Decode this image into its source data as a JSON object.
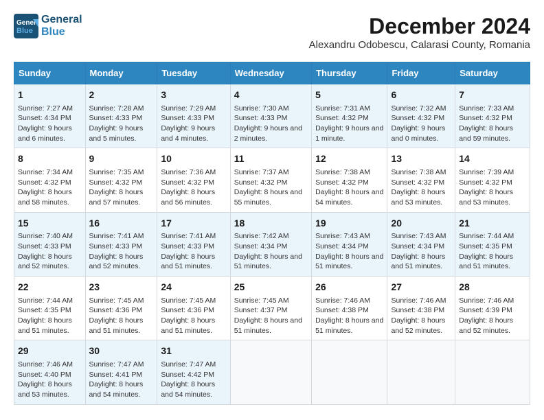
{
  "logo": {
    "line1": "General",
    "line2": "Blue"
  },
  "title": "December 2024",
  "subtitle": "Alexandru Odobescu, Calarasi County, Romania",
  "headers": [
    "Sunday",
    "Monday",
    "Tuesday",
    "Wednesday",
    "Thursday",
    "Friday",
    "Saturday"
  ],
  "weeks": [
    [
      {
        "day": "1",
        "info": "Sunrise: 7:27 AM\nSunset: 4:34 PM\nDaylight: 9 hours and 6 minutes."
      },
      {
        "day": "2",
        "info": "Sunrise: 7:28 AM\nSunset: 4:33 PM\nDaylight: 9 hours and 5 minutes."
      },
      {
        "day": "3",
        "info": "Sunrise: 7:29 AM\nSunset: 4:33 PM\nDaylight: 9 hours and 4 minutes."
      },
      {
        "day": "4",
        "info": "Sunrise: 7:30 AM\nSunset: 4:33 PM\nDaylight: 9 hours and 2 minutes."
      },
      {
        "day": "5",
        "info": "Sunrise: 7:31 AM\nSunset: 4:32 PM\nDaylight: 9 hours and 1 minute."
      },
      {
        "day": "6",
        "info": "Sunrise: 7:32 AM\nSunset: 4:32 PM\nDaylight: 9 hours and 0 minutes."
      },
      {
        "day": "7",
        "info": "Sunrise: 7:33 AM\nSunset: 4:32 PM\nDaylight: 8 hours and 59 minutes."
      }
    ],
    [
      {
        "day": "8",
        "info": "Sunrise: 7:34 AM\nSunset: 4:32 PM\nDaylight: 8 hours and 58 minutes."
      },
      {
        "day": "9",
        "info": "Sunrise: 7:35 AM\nSunset: 4:32 PM\nDaylight: 8 hours and 57 minutes."
      },
      {
        "day": "10",
        "info": "Sunrise: 7:36 AM\nSunset: 4:32 PM\nDaylight: 8 hours and 56 minutes."
      },
      {
        "day": "11",
        "info": "Sunrise: 7:37 AM\nSunset: 4:32 PM\nDaylight: 8 hours and 55 minutes."
      },
      {
        "day": "12",
        "info": "Sunrise: 7:38 AM\nSunset: 4:32 PM\nDaylight: 8 hours and 54 minutes."
      },
      {
        "day": "13",
        "info": "Sunrise: 7:38 AM\nSunset: 4:32 PM\nDaylight: 8 hours and 53 minutes."
      },
      {
        "day": "14",
        "info": "Sunrise: 7:39 AM\nSunset: 4:32 PM\nDaylight: 8 hours and 53 minutes."
      }
    ],
    [
      {
        "day": "15",
        "info": "Sunrise: 7:40 AM\nSunset: 4:33 PM\nDaylight: 8 hours and 52 minutes."
      },
      {
        "day": "16",
        "info": "Sunrise: 7:41 AM\nSunset: 4:33 PM\nDaylight: 8 hours and 52 minutes."
      },
      {
        "day": "17",
        "info": "Sunrise: 7:41 AM\nSunset: 4:33 PM\nDaylight: 8 hours and 51 minutes."
      },
      {
        "day": "18",
        "info": "Sunrise: 7:42 AM\nSunset: 4:34 PM\nDaylight: 8 hours and 51 minutes."
      },
      {
        "day": "19",
        "info": "Sunrise: 7:43 AM\nSunset: 4:34 PM\nDaylight: 8 hours and 51 minutes."
      },
      {
        "day": "20",
        "info": "Sunrise: 7:43 AM\nSunset: 4:34 PM\nDaylight: 8 hours and 51 minutes."
      },
      {
        "day": "21",
        "info": "Sunrise: 7:44 AM\nSunset: 4:35 PM\nDaylight: 8 hours and 51 minutes."
      }
    ],
    [
      {
        "day": "22",
        "info": "Sunrise: 7:44 AM\nSunset: 4:35 PM\nDaylight: 8 hours and 51 minutes."
      },
      {
        "day": "23",
        "info": "Sunrise: 7:45 AM\nSunset: 4:36 PM\nDaylight: 8 hours and 51 minutes."
      },
      {
        "day": "24",
        "info": "Sunrise: 7:45 AM\nSunset: 4:36 PM\nDaylight: 8 hours and 51 minutes."
      },
      {
        "day": "25",
        "info": "Sunrise: 7:45 AM\nSunset: 4:37 PM\nDaylight: 8 hours and 51 minutes."
      },
      {
        "day": "26",
        "info": "Sunrise: 7:46 AM\nSunset: 4:38 PM\nDaylight: 8 hours and 51 minutes."
      },
      {
        "day": "27",
        "info": "Sunrise: 7:46 AM\nSunset: 4:38 PM\nDaylight: 8 hours and 52 minutes."
      },
      {
        "day": "28",
        "info": "Sunrise: 7:46 AM\nSunset: 4:39 PM\nDaylight: 8 hours and 52 minutes."
      }
    ],
    [
      {
        "day": "29",
        "info": "Sunrise: 7:46 AM\nSunset: 4:40 PM\nDaylight: 8 hours and 53 minutes."
      },
      {
        "day": "30",
        "info": "Sunrise: 7:47 AM\nSunset: 4:41 PM\nDaylight: 8 hours and 54 minutes."
      },
      {
        "day": "31",
        "info": "Sunrise: 7:47 AM\nSunset: 4:42 PM\nDaylight: 8 hours and 54 minutes."
      },
      {
        "day": "",
        "info": ""
      },
      {
        "day": "",
        "info": ""
      },
      {
        "day": "",
        "info": ""
      },
      {
        "day": "",
        "info": ""
      }
    ]
  ]
}
